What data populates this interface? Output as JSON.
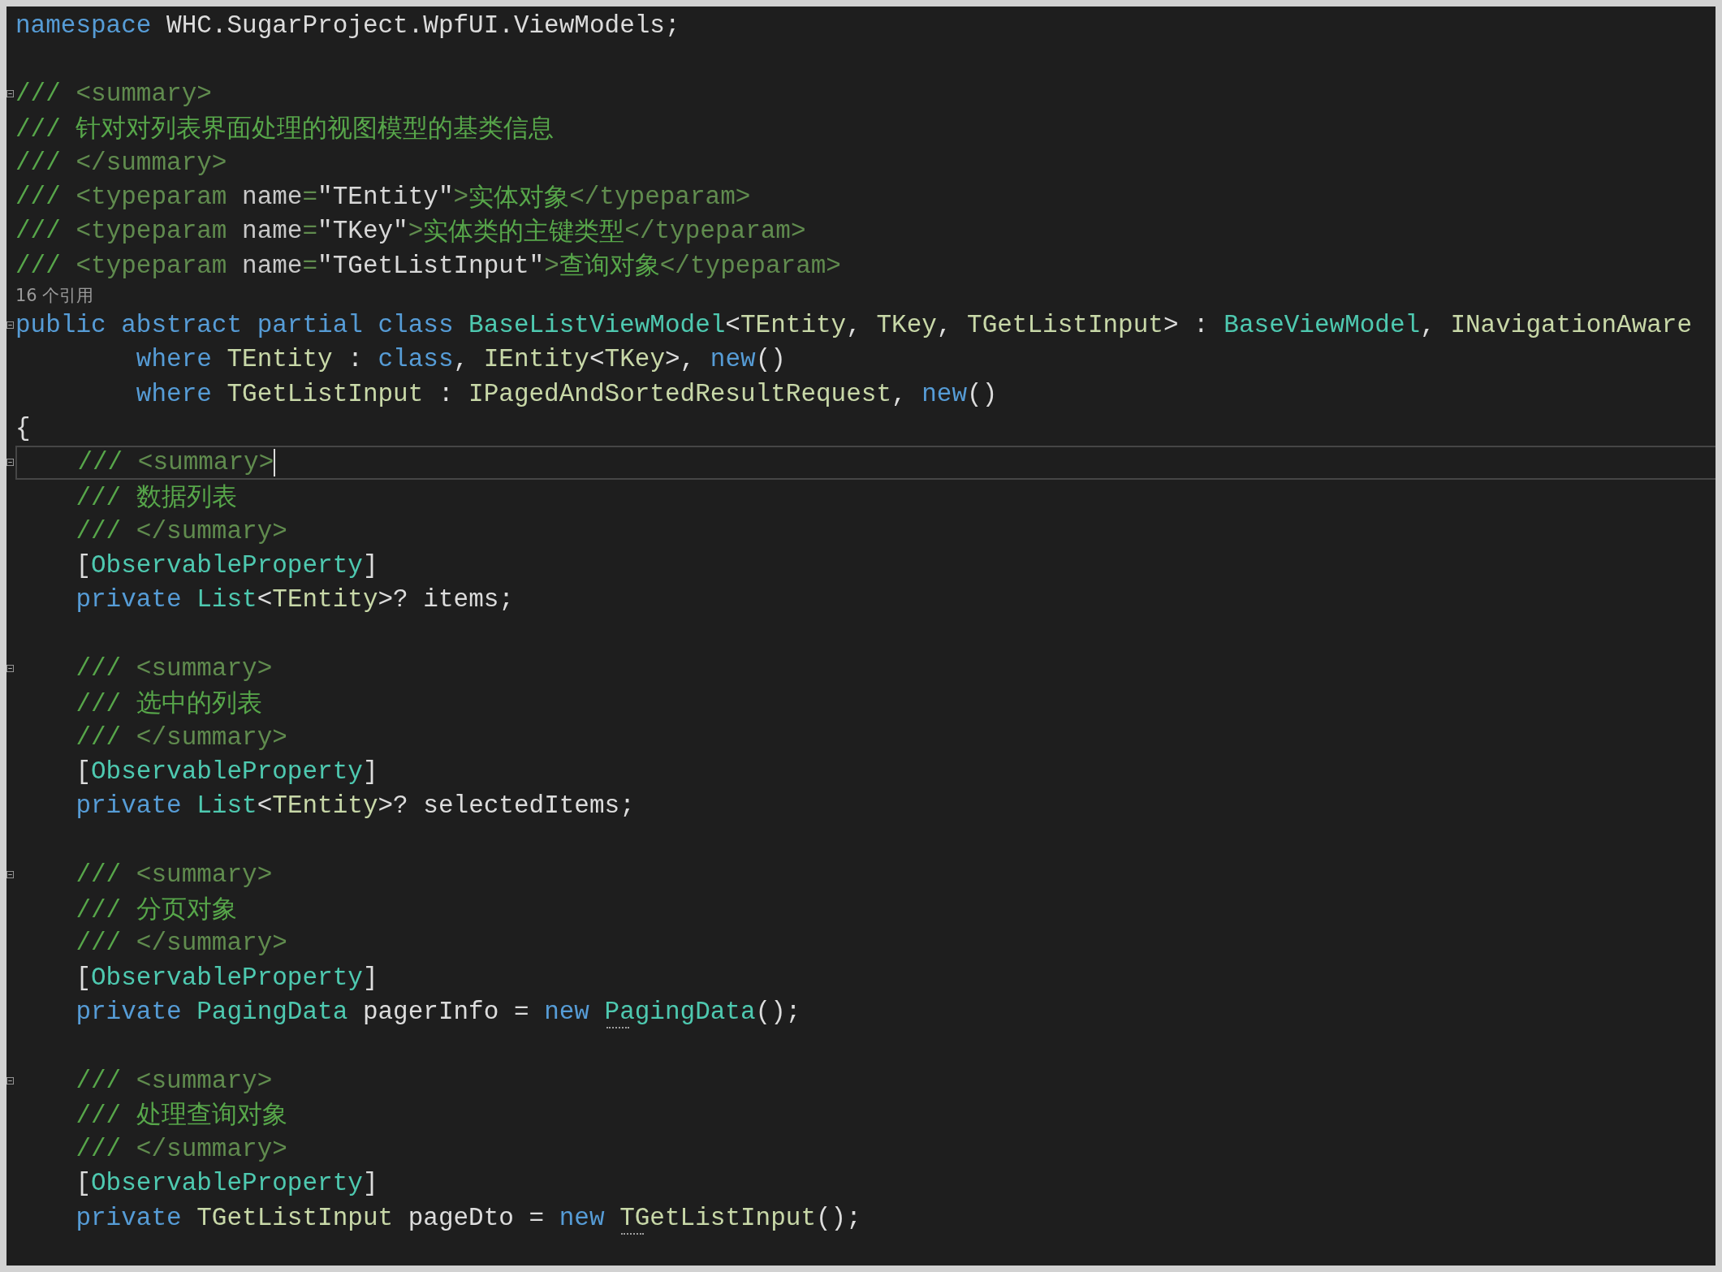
{
  "editor": {
    "lines": [
      {
        "kind": "code",
        "foldable": false,
        "current": false,
        "tokens": [
          {
            "kind": "kw",
            "text": "namespace"
          },
          {
            "kind": "plain",
            "text": " WHC.SugarProject.WpfUI.ViewModels;"
          }
        ]
      },
      {
        "kind": "blank",
        "foldable": false,
        "current": false
      },
      {
        "kind": "code",
        "foldable": true,
        "current": false,
        "tokens": [
          {
            "kind": "comment",
            "text": "/// "
          },
          {
            "kind": "doc",
            "text": "<summary>"
          }
        ]
      },
      {
        "kind": "code",
        "foldable": false,
        "current": false,
        "tokens": [
          {
            "kind": "comment",
            "text": "/// 针对对列表界面处理的视图模型的基类信息"
          }
        ]
      },
      {
        "kind": "code",
        "foldable": false,
        "current": false,
        "tokens": [
          {
            "kind": "comment",
            "text": "/// "
          },
          {
            "kind": "doc",
            "text": "</summary>"
          }
        ]
      },
      {
        "kind": "code",
        "foldable": false,
        "current": false,
        "tokens": [
          {
            "kind": "comment",
            "text": "/// "
          },
          {
            "kind": "doc",
            "text": "<typeparam"
          },
          {
            "kind": "attr",
            "text": " name"
          },
          {
            "kind": "doc",
            "text": "="
          },
          {
            "kind": "str",
            "text": "\"TEntity\""
          },
          {
            "kind": "doc",
            "text": ">"
          },
          {
            "kind": "comment",
            "text": "实体对象"
          },
          {
            "kind": "doc",
            "text": "</typeparam>"
          }
        ]
      },
      {
        "kind": "code",
        "foldable": false,
        "current": false,
        "tokens": [
          {
            "kind": "comment",
            "text": "/// "
          },
          {
            "kind": "doc",
            "text": "<typeparam"
          },
          {
            "kind": "attr",
            "text": " name"
          },
          {
            "kind": "doc",
            "text": "="
          },
          {
            "kind": "str",
            "text": "\"TKey\""
          },
          {
            "kind": "doc",
            "text": ">"
          },
          {
            "kind": "comment",
            "text": "实体类的主键类型"
          },
          {
            "kind": "doc",
            "text": "</typeparam>"
          }
        ]
      },
      {
        "kind": "code",
        "foldable": false,
        "current": false,
        "tokens": [
          {
            "kind": "comment",
            "text": "/// "
          },
          {
            "kind": "doc",
            "text": "<typeparam"
          },
          {
            "kind": "attr",
            "text": " name"
          },
          {
            "kind": "doc",
            "text": "="
          },
          {
            "kind": "str",
            "text": "\"TGetListInput\""
          },
          {
            "kind": "doc",
            "text": ">"
          },
          {
            "kind": "comment",
            "text": "查询对象"
          },
          {
            "kind": "doc",
            "text": "</typeparam>"
          }
        ]
      },
      {
        "kind": "codelens",
        "foldable": false,
        "current": false,
        "text": "16 个引用"
      },
      {
        "kind": "code",
        "foldable": true,
        "current": false,
        "tokens": [
          {
            "kind": "kw",
            "text": "public abstract partial class "
          },
          {
            "kind": "type",
            "text": "BaseListViewModel"
          },
          {
            "kind": "plain",
            "text": "<"
          },
          {
            "kind": "iface",
            "text": "TEntity"
          },
          {
            "kind": "plain",
            "text": ", "
          },
          {
            "kind": "iface",
            "text": "TKey"
          },
          {
            "kind": "plain",
            "text": ", "
          },
          {
            "kind": "iface",
            "text": "TGetListInput"
          },
          {
            "kind": "plain",
            "text": "> : "
          },
          {
            "kind": "type",
            "text": "BaseViewModel"
          },
          {
            "kind": "plain",
            "text": ", "
          },
          {
            "kind": "iface",
            "text": "INavigationAware"
          }
        ]
      },
      {
        "kind": "code",
        "foldable": false,
        "current": false,
        "tokens": [
          {
            "kind": "kw",
            "text": "        where "
          },
          {
            "kind": "iface",
            "text": "TEntity"
          },
          {
            "kind": "plain",
            "text": " : "
          },
          {
            "kind": "kw",
            "text": "class"
          },
          {
            "kind": "plain",
            "text": ", "
          },
          {
            "kind": "iface",
            "text": "IEntity"
          },
          {
            "kind": "plain",
            "text": "<"
          },
          {
            "kind": "iface",
            "text": "TKey"
          },
          {
            "kind": "plain",
            "text": ">, "
          },
          {
            "kind": "kw",
            "text": "new"
          },
          {
            "kind": "plain",
            "text": "()"
          }
        ]
      },
      {
        "kind": "code",
        "foldable": false,
        "current": false,
        "tokens": [
          {
            "kind": "kw",
            "text": "        where "
          },
          {
            "kind": "iface",
            "text": "TGetListInput"
          },
          {
            "kind": "plain",
            "text": " : "
          },
          {
            "kind": "iface",
            "text": "IPagedAndSortedResultRequest"
          },
          {
            "kind": "plain",
            "text": ", "
          },
          {
            "kind": "kw",
            "text": "new"
          },
          {
            "kind": "plain",
            "text": "()"
          }
        ]
      },
      {
        "kind": "code",
        "foldable": false,
        "current": false,
        "tokens": [
          {
            "kind": "plain",
            "text": "{"
          }
        ]
      },
      {
        "kind": "code",
        "foldable": true,
        "current": true,
        "tokens": [
          {
            "kind": "comment",
            "text": "    /// "
          },
          {
            "kind": "doc",
            "text": "<summary>"
          }
        ]
      },
      {
        "kind": "code",
        "foldable": false,
        "current": false,
        "tokens": [
          {
            "kind": "comment",
            "text": "    /// 数据列表"
          }
        ]
      },
      {
        "kind": "code",
        "foldable": false,
        "current": false,
        "tokens": [
          {
            "kind": "comment",
            "text": "    /// "
          },
          {
            "kind": "doc",
            "text": "</summary>"
          }
        ]
      },
      {
        "kind": "code",
        "foldable": false,
        "current": false,
        "tokens": [
          {
            "kind": "plain",
            "text": "    ["
          },
          {
            "kind": "type",
            "text": "ObservableProperty"
          },
          {
            "kind": "plain",
            "text": "]"
          }
        ]
      },
      {
        "kind": "code",
        "foldable": false,
        "current": false,
        "tokens": [
          {
            "kind": "kw",
            "text": "    private "
          },
          {
            "kind": "type",
            "text": "List"
          },
          {
            "kind": "plain",
            "text": "<"
          },
          {
            "kind": "iface",
            "text": "TEntity"
          },
          {
            "kind": "plain",
            "text": ">? items;"
          }
        ]
      },
      {
        "kind": "blank",
        "foldable": false,
        "current": false
      },
      {
        "kind": "code",
        "foldable": true,
        "current": false,
        "tokens": [
          {
            "kind": "comment",
            "text": "    /// "
          },
          {
            "kind": "doc",
            "text": "<summary>"
          }
        ]
      },
      {
        "kind": "code",
        "foldable": false,
        "current": false,
        "tokens": [
          {
            "kind": "comment",
            "text": "    /// 选中的列表"
          }
        ]
      },
      {
        "kind": "code",
        "foldable": false,
        "current": false,
        "tokens": [
          {
            "kind": "comment",
            "text": "    /// "
          },
          {
            "kind": "doc",
            "text": "</summary>"
          }
        ]
      },
      {
        "kind": "code",
        "foldable": false,
        "current": false,
        "tokens": [
          {
            "kind": "plain",
            "text": "    ["
          },
          {
            "kind": "type",
            "text": "ObservableProperty"
          },
          {
            "kind": "plain",
            "text": "]"
          }
        ]
      },
      {
        "kind": "code",
        "foldable": false,
        "current": false,
        "tokens": [
          {
            "kind": "kw",
            "text": "    private "
          },
          {
            "kind": "type",
            "text": "List"
          },
          {
            "kind": "plain",
            "text": "<"
          },
          {
            "kind": "iface",
            "text": "TEntity"
          },
          {
            "kind": "plain",
            "text": ">? selectedItems;"
          }
        ]
      },
      {
        "kind": "blank",
        "foldable": false,
        "current": false
      },
      {
        "kind": "code",
        "foldable": true,
        "current": false,
        "tokens": [
          {
            "kind": "comment",
            "text": "    /// "
          },
          {
            "kind": "doc",
            "text": "<summary>"
          }
        ]
      },
      {
        "kind": "code",
        "foldable": false,
        "current": false,
        "tokens": [
          {
            "kind": "comment",
            "text": "    /// 分页对象"
          }
        ]
      },
      {
        "kind": "code",
        "foldable": false,
        "current": false,
        "tokens": [
          {
            "kind": "comment",
            "text": "    /// "
          },
          {
            "kind": "doc",
            "text": "</summary>"
          }
        ]
      },
      {
        "kind": "code",
        "foldable": false,
        "current": false,
        "tokens": [
          {
            "kind": "plain",
            "text": "    ["
          },
          {
            "kind": "type",
            "text": "ObservableProperty"
          },
          {
            "kind": "plain",
            "text": "]"
          }
        ]
      },
      {
        "kind": "code",
        "foldable": false,
        "current": false,
        "tokens": [
          {
            "kind": "kw",
            "text": "    private "
          },
          {
            "kind": "type",
            "text": "PagingData"
          },
          {
            "kind": "plain",
            "text": " pagerInfo = "
          },
          {
            "kind": "kw",
            "text": "new "
          },
          {
            "kind": "type",
            "text": "PagingData",
            "suggestion": true
          },
          {
            "kind": "plain",
            "text": "();"
          }
        ]
      },
      {
        "kind": "blank",
        "foldable": false,
        "current": false
      },
      {
        "kind": "code",
        "foldable": true,
        "current": false,
        "tokens": [
          {
            "kind": "comment",
            "text": "    /// "
          },
          {
            "kind": "doc",
            "text": "<summary>"
          }
        ]
      },
      {
        "kind": "code",
        "foldable": false,
        "current": false,
        "tokens": [
          {
            "kind": "comment",
            "text": "    /// 处理查询对象"
          }
        ]
      },
      {
        "kind": "code",
        "foldable": false,
        "current": false,
        "tokens": [
          {
            "kind": "comment",
            "text": "    /// "
          },
          {
            "kind": "doc",
            "text": "</summary>"
          }
        ]
      },
      {
        "kind": "code",
        "foldable": false,
        "current": false,
        "tokens": [
          {
            "kind": "plain",
            "text": "    ["
          },
          {
            "kind": "type",
            "text": "ObservableProperty"
          },
          {
            "kind": "plain",
            "text": "]"
          }
        ]
      },
      {
        "kind": "code",
        "foldable": false,
        "current": false,
        "tokens": [
          {
            "kind": "kw",
            "text": "    private "
          },
          {
            "kind": "iface",
            "text": "TGetListInput"
          },
          {
            "kind": "plain",
            "text": " pageDto = "
          },
          {
            "kind": "kw",
            "text": "new "
          },
          {
            "kind": "iface",
            "text": "TGetListInput",
            "suggestion": true
          },
          {
            "kind": "plain",
            "text": "();"
          }
        ]
      }
    ]
  }
}
